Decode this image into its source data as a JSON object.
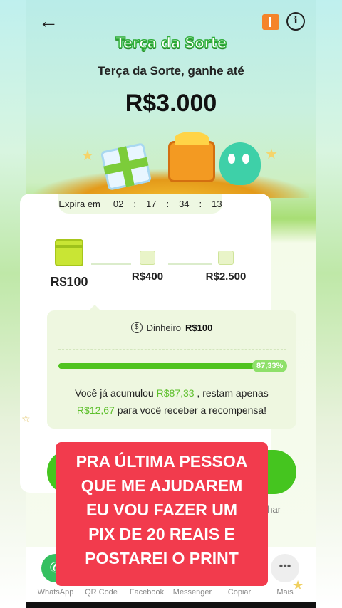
{
  "header": {
    "brand": "Terça da Sorte",
    "subtitle": "Terça da Sorte, ganhe até",
    "amount": "R$3.000"
  },
  "icons": {
    "back": "arrow-left-icon",
    "ticket": "ticket-icon",
    "info": "info-icon"
  },
  "expire": {
    "label": "Expira em",
    "h": "02",
    "m": "17",
    "s": "34",
    "ms": "13"
  },
  "steps": [
    {
      "value": "R$100"
    },
    {
      "value": "R$400"
    },
    {
      "value": "R$2.500"
    }
  ],
  "reward": {
    "label": "Dinheiro",
    "value": "R$100"
  },
  "progress": {
    "percent": 87.33,
    "percent_label": "87,33%",
    "text_before": "Você já acumulou",
    "accumulated": "R$87,33",
    "text_middle": ", restam apenas",
    "remaining": "R$12,67",
    "text_after": "para você receber a recompensa!"
  },
  "overlay": {
    "lines": [
      "PRA ÚLTIMA PESSOA",
      "QUE ME AJUDAREM",
      "EU VOU FAZER UM",
      "PIX DE 20 REAIS E",
      "POSTAREI O PRINT"
    ]
  },
  "share_partial": "nhar",
  "share": [
    {
      "label": "WhatsApp"
    },
    {
      "label": "QR Code"
    },
    {
      "label": "Facebook"
    },
    {
      "label": "Messenger"
    },
    {
      "label": "Copiar"
    },
    {
      "label": "Mais"
    }
  ],
  "colors": {
    "accent": "#45c51f",
    "overlay": "#f23b4d",
    "highlight": "#5cbf2a"
  }
}
